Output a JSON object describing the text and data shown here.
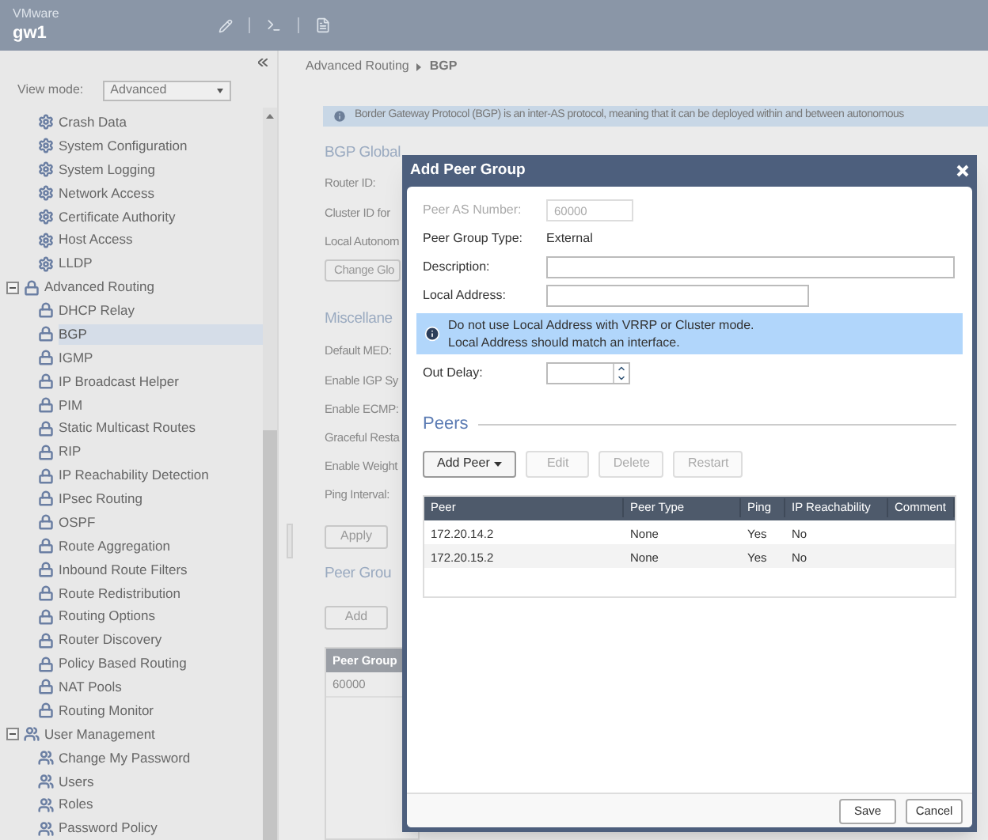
{
  "header": {
    "brand": "VMware",
    "hostname": "gw1"
  },
  "sidebar": {
    "view_mode_label": "View mode:",
    "view_mode": "Advanced",
    "items": [
      {
        "label": "Crash Data",
        "kind": "gear",
        "selected": false
      },
      {
        "label": "System Configuration",
        "kind": "gear",
        "selected": false
      },
      {
        "label": "System Logging",
        "kind": "gear",
        "selected": false
      },
      {
        "label": "Network Access",
        "kind": "gear",
        "selected": false
      },
      {
        "label": "Certificate Authority",
        "kind": "gear",
        "selected": false
      },
      {
        "label": "Host Access",
        "kind": "gear",
        "selected": false
      },
      {
        "label": "LLDP",
        "kind": "gear",
        "selected": false
      },
      {
        "label": "Advanced Routing",
        "kind": "lock",
        "expanded": true,
        "selected": false,
        "children": [
          {
            "label": "DHCP Relay",
            "kind": "lock",
            "selected": false
          },
          {
            "label": "BGP",
            "kind": "lock",
            "selected": true
          },
          {
            "label": "IGMP",
            "kind": "lock",
            "selected": false
          },
          {
            "label": "IP Broadcast Helper",
            "kind": "lock",
            "selected": false
          },
          {
            "label": "PIM",
            "kind": "lock",
            "selected": false
          },
          {
            "label": "Static Multicast Routes",
            "kind": "lock",
            "selected": false
          },
          {
            "label": "RIP",
            "kind": "lock",
            "selected": false
          },
          {
            "label": "IP Reachability Detection",
            "kind": "lock",
            "selected": false
          },
          {
            "label": "IPsec Routing",
            "kind": "lock",
            "selected": false
          },
          {
            "label": "OSPF",
            "kind": "lock",
            "selected": false
          },
          {
            "label": "Route Aggregation",
            "kind": "lock",
            "selected": false
          },
          {
            "label": "Inbound Route Filters",
            "kind": "lock",
            "selected": false
          },
          {
            "label": "Route Redistribution",
            "kind": "lock",
            "selected": false
          },
          {
            "label": "Routing Options",
            "kind": "lock",
            "selected": false
          },
          {
            "label": "Router Discovery",
            "kind": "lock",
            "selected": false
          },
          {
            "label": "Policy Based Routing",
            "kind": "lock",
            "selected": false
          },
          {
            "label": "NAT Pools",
            "kind": "lock",
            "selected": false
          },
          {
            "label": "Routing Monitor",
            "kind": "lock",
            "selected": false
          }
        ]
      },
      {
        "label": "User Management",
        "kind": "user",
        "expanded": true,
        "selected": false,
        "children": [
          {
            "label": "Change My Password",
            "kind": "user",
            "selected": false
          },
          {
            "label": "Users",
            "kind": "user",
            "selected": false
          },
          {
            "label": "Roles",
            "kind": "user",
            "selected": false
          },
          {
            "label": "Password Policy",
            "kind": "user",
            "selected": false
          }
        ]
      }
    ]
  },
  "breadcrumb": [
    "Advanced Routing",
    "BGP"
  ],
  "info_banner": "Border Gateway Protocol (BGP) is an inter-AS protocol, meaning that it can be deployed within and between autonomous",
  "global_section": {
    "title": "BGP Global",
    "fields": [
      "Router ID:",
      "Cluster ID for",
      "Local Autonom"
    ],
    "button": "Change Glo"
  },
  "misc_section": {
    "title": "Miscellane",
    "fields": [
      "Default MED:",
      "Enable IGP Sy",
      "Enable ECMP:",
      "Graceful Resta",
      "Enable Weight",
      "Ping Interval:"
    ],
    "button": "Apply"
  },
  "peer_groups_section": {
    "title": "Peer Grou",
    "button": "Add",
    "table": {
      "columns": [
        "Peer Group"
      ],
      "rows": [
        [
          "60000"
        ]
      ]
    }
  },
  "dialog": {
    "title": "Add Peer Group",
    "fields": [
      {
        "kind": "input",
        "label": "Peer AS Number:",
        "value": "60000",
        "disabled": true
      },
      {
        "kind": "text",
        "label": "Peer Group Type:",
        "value": "External"
      },
      {
        "kind": "input",
        "label": "Description:",
        "disabled": false
      },
      {
        "kind": "input",
        "label": "Local Address:",
        "disabled": false
      },
      {
        "kind": "alert",
        "lines": [
          "Do not use Local Address with VRRP or Cluster mode.",
          "Local Address should match an interface."
        ]
      },
      {
        "kind": "spinner",
        "label": "Out Delay:"
      }
    ],
    "peers_title": "Peers",
    "buttons": [
      {
        "label": "Add Peer",
        "disabled": false,
        "dropdown": true
      },
      {
        "label": "Edit",
        "disabled": true
      },
      {
        "label": "Delete",
        "disabled": true
      },
      {
        "label": "Restart",
        "disabled": true
      }
    ],
    "table": {
      "columns": [
        "Peer",
        "Peer Type",
        "Ping",
        "IP Reachability",
        "Comment"
      ],
      "rows": [
        [
          "172.20.14.2",
          "None",
          "Yes",
          "No",
          ""
        ],
        [
          "172.20.15.2",
          "None",
          "Yes",
          "No",
          ""
        ]
      ]
    },
    "footer_buttons": [
      "Save",
      "Cancel"
    ]
  }
}
